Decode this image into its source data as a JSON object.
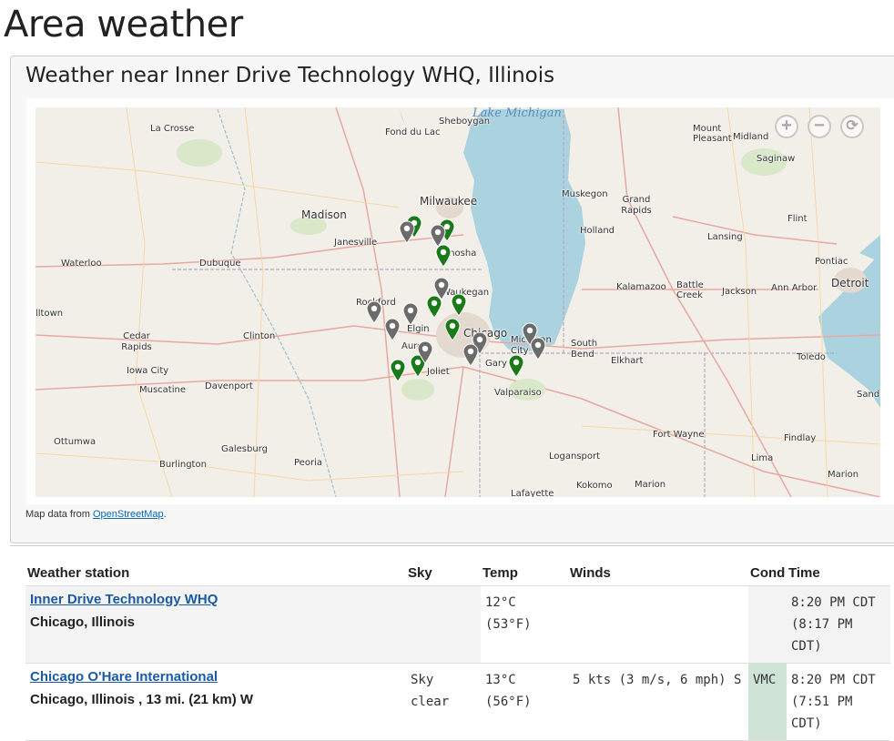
{
  "page": {
    "title": "Area weather"
  },
  "map_panel": {
    "title": "Weather near Inner Drive Technology WHQ, Illinois",
    "attribution_prefix": "Map data from ",
    "attribution_link": "OpenStreetMap",
    "attribution_suffix": ".",
    "zoom_in": "+",
    "zoom_out": "−",
    "reset": "⟳",
    "colors": {
      "water": "#aad3df",
      "land": "#f2efe9",
      "marker_green": "#1a7a1a",
      "marker_gray": "#6b6b6b"
    },
    "cities": [
      "La Crosse",
      "Fond du Lac",
      "Sheboygan",
      "Mount Pleasant",
      "Midland",
      "Saginaw",
      "Madison",
      "Milwaukee",
      "Muskegon",
      "Grand Rapids",
      "Flint",
      "Janesville",
      "Kenosha",
      "Holland",
      "Lansing",
      "Waterloo",
      "Dubuque",
      "Rockford",
      "Waukegan",
      "Kalamazoo",
      "Battle Creek",
      "Jackson",
      "Ann Arbor",
      "Pontiac",
      "Detroit",
      "lltown",
      "Cedar Rapids",
      "Clinton",
      "Elgin",
      "Aurora",
      "Chicago",
      "Michigan City",
      "South Bend",
      "Iowa City",
      "Elkhart",
      "Toledo",
      "Muscatine",
      "Davenport",
      "Joliet",
      "Gary",
      "Valparaiso",
      "Sandusky",
      "Ottumwa",
      "Galesburg",
      "Fort Wayne",
      "Findlay",
      "Burlington",
      "Peoria",
      "Logansport",
      "Lima",
      "Marion",
      "Kokomo",
      "Marion",
      "Lafayette"
    ],
    "lake_label": "Lake Michigan"
  },
  "table": {
    "headers": [
      "Weather station",
      "Sky",
      "Temp",
      "Winds",
      "Cond",
      "Time"
    ],
    "rows": [
      {
        "station": "Inner Drive Technology WHQ",
        "location": "Chicago, Illinois",
        "sky": "",
        "temp_c": "12°C",
        "temp_f": "(53°F)",
        "winds": "",
        "cond": "",
        "time": "8:20 PM CDT",
        "time_obs": "(8:17 PM",
        "time_tz": "CDT)"
      },
      {
        "station": "Chicago O'Hare International",
        "location": "Chicago, Illinois , 13 mi. (21 km) W",
        "sky": "Sky",
        "sky2": "clear",
        "temp_c": "13°C",
        "temp_f": "(56°F)",
        "winds": "5 kts (3 m/s, 6 mph) S",
        "cond": "VMC",
        "time": "8:20 PM CDT",
        "time_obs": "(7:51 PM",
        "time_tz": "CDT)"
      }
    ]
  }
}
